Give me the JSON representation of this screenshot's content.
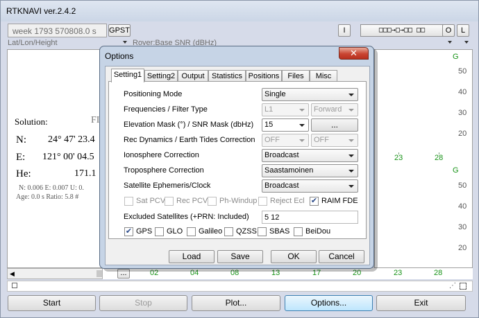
{
  "app": {
    "title": "RTKNAVI ver.2.4.2"
  },
  "toolbar": {
    "week": "week 1793 570808.0 s",
    "time_sys": "GPST",
    "btn_i": "I",
    "stream_status": "□□□→□→□□ □□",
    "btn_o": "O",
    "btn_l": "L"
  },
  "left_panel": {
    "mode_select": "Lat/Lon/Height",
    "solution_label": "Solution:",
    "solution_value": "FI",
    "lat_label": "N:",
    "lat_value": "24° 47' 23.4",
    "lon_label": "E:",
    "lon_value": "121° 00' 04.5",
    "hgt_label": "He:",
    "hgt_value": "171.1",
    "std_line": "N: 0.006 E: 0.007 U: 0.",
    "age_line": "Age: 0.0 s Ratio: 5.8 #"
  },
  "right_panel": {
    "select": "Rover:Base SNR (dBHz)",
    "g_label": "G",
    "axis_top": [
      "50",
      "40",
      "30",
      "20"
    ],
    "axis_bottom": [
      "50",
      "40",
      "30",
      "20"
    ],
    "sats_top": [
      "23",
      "28"
    ],
    "sats_bottom": [
      "02",
      "04",
      "08",
      "13",
      "17",
      "20",
      "23",
      "28"
    ],
    "nav_btn": "..."
  },
  "bottom_bar": {
    "start": "Start",
    "stop": "Stop",
    "plot": "Plot...",
    "options": "Options...",
    "exit": "Exit"
  },
  "dialog": {
    "title": "Options",
    "close": "✕",
    "tabs": [
      "Setting1",
      "Setting2",
      "Output",
      "Statistics",
      "Positions",
      "Files",
      "Misc"
    ],
    "positioning_mode": {
      "label": "Positioning Mode",
      "value": "Single"
    },
    "frequencies": {
      "label": "Frequencies / Filter Type",
      "value": "L1",
      "filter": "Forward"
    },
    "elevation_mask": {
      "label": "Elevation Mask (°) / SNR Mask (dbHz)",
      "value": "15",
      "btn": "..."
    },
    "rec_dynamics": {
      "label": "Rec Dynamics / Earth Tides Correction",
      "value": "OFF",
      "tides": "OFF"
    },
    "ionosphere": {
      "label": "Ionosphere Correction",
      "value": "Broadcast"
    },
    "troposphere": {
      "label": "Troposphere Correction",
      "value": "Saastamoinen"
    },
    "ephemeris": {
      "label": "Satellite Ephemeris/Clock",
      "value": "Broadcast"
    },
    "checks": {
      "sat_pcv": "Sat PCV",
      "rec_pcv": "Rec PCV",
      "ph_windup": "Ph-Windup",
      "reject_ecl": "Reject Ecl",
      "raim_fde": "RAIM FDE"
    },
    "excluded": {
      "label": "Excluded Satellites (+PRN: Included)",
      "value": "5 12"
    },
    "systems": {
      "gps": "GPS",
      "glo": "GLO",
      "galileo": "Galileo",
      "qzss": "QZSS",
      "sbas": "SBAS",
      "beidou": "BeiDou"
    },
    "buttons": {
      "load": "Load",
      "save": "Save",
      "ok": "OK",
      "cancel": "Cancel"
    },
    "check_mark": "✔"
  }
}
